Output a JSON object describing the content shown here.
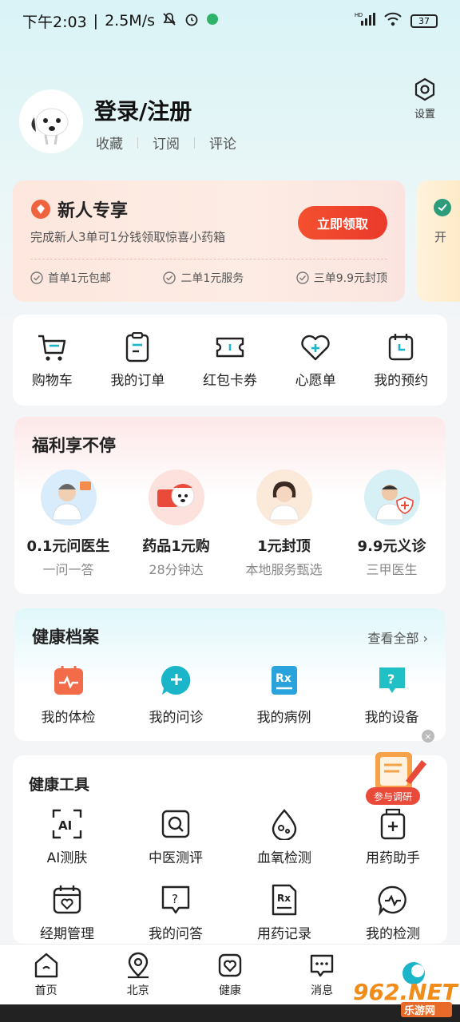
{
  "status_bar": {
    "time": "下午2:03",
    "speed": "2.5M/s",
    "battery": "37",
    "signal_label": "HD"
  },
  "profile": {
    "login": "登录/注册",
    "links": [
      "收藏",
      "订阅",
      "评论"
    ],
    "settings_label": "设置"
  },
  "promo": {
    "title": "新人专享",
    "subtitle": "完成新人3单可1分钱领取惊喜小药箱",
    "button": "立即领取",
    "perks": [
      "首单1元包邮",
      "二单1元服务",
      "三单9.9元封顶"
    ],
    "peek_text": "开"
  },
  "quick_actions": [
    {
      "label": "购物车",
      "icon": "cart-icon"
    },
    {
      "label": "我的订单",
      "icon": "order-icon"
    },
    {
      "label": "红包卡券",
      "icon": "coupon-icon"
    },
    {
      "label": "心愿单",
      "icon": "wishlist-icon"
    },
    {
      "label": "我的预约",
      "icon": "appointment-icon"
    }
  ],
  "welfare": {
    "title": "福利享不停",
    "items": [
      {
        "name": "0.1元问医生",
        "sub": "一问一答"
      },
      {
        "name": "药品1元购",
        "sub": "28分钟达"
      },
      {
        "name": "1元封顶",
        "sub": "本地服务甄选"
      },
      {
        "name": "9.9元义诊",
        "sub": "三甲医生"
      }
    ]
  },
  "health_records": {
    "title": "健康档案",
    "see_all": "查看全部",
    "items": [
      {
        "label": "我的体检",
        "icon": "checkup-icon"
      },
      {
        "label": "我的问诊",
        "icon": "consult-icon"
      },
      {
        "label": "我的病例",
        "icon": "rx-icon"
      },
      {
        "label": "我的设备",
        "icon": "device-icon"
      }
    ]
  },
  "tools": {
    "title": "健康工具",
    "items": [
      {
        "label": "AI测肤",
        "icon": "ai-skin-icon"
      },
      {
        "label": "中医测评",
        "icon": "tcm-search-icon"
      },
      {
        "label": "血氧检测",
        "icon": "oxygen-drop-icon"
      },
      {
        "label": "用药助手",
        "icon": "medicine-box-icon"
      },
      {
        "label": "经期管理",
        "icon": "calendar-heart-icon"
      },
      {
        "label": "我的问答",
        "icon": "question-bubble-icon"
      },
      {
        "label": "用药记录",
        "icon": "rx-doc-icon"
      },
      {
        "label": "我的检测",
        "icon": "pulse-bubble-icon"
      }
    ]
  },
  "survey": {
    "label": "参与调研"
  },
  "tabbar": [
    {
      "label": "首页",
      "icon": "home-icon"
    },
    {
      "label": "北京",
      "icon": "location-icon"
    },
    {
      "label": "健康",
      "icon": "health-icon"
    },
    {
      "label": "消息",
      "icon": "message-icon"
    },
    {
      "label": "",
      "icon": "brand-icon"
    }
  ],
  "watermark": {
    "text": "962.NET",
    "sub": "乐游网"
  },
  "colors": {
    "accent_red": "#ea3a2b",
    "teal": "#1bb5c9",
    "orange": "#f0703a"
  }
}
